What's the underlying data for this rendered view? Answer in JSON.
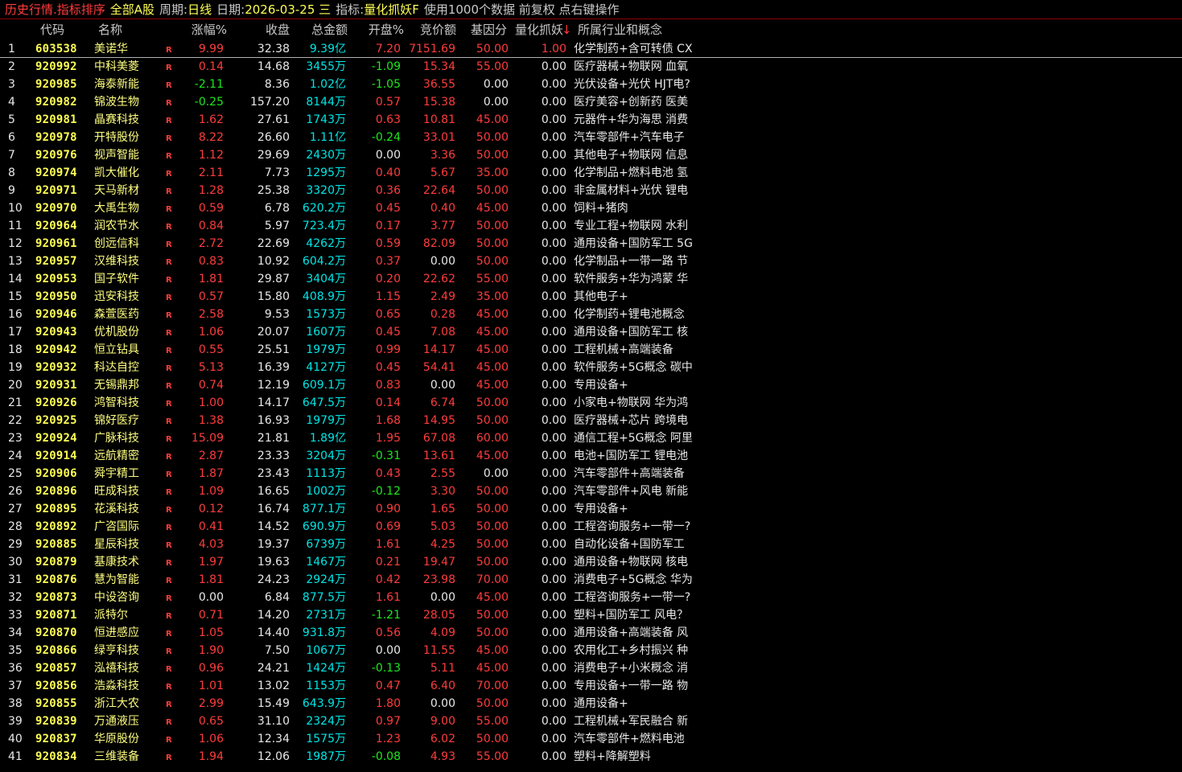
{
  "topbar": {
    "title": "历史行情.指标排序",
    "market": "全部A股",
    "period_label": "周期:",
    "period_value": "日线",
    "date_label": "日期:",
    "date_value": "2026-03-25 三",
    "indicator_label": "指标:",
    "indicator_value": "量化抓妖F",
    "hint": "使用1000个数据 前复权 点右键操作"
  },
  "columns": {
    "code": "代码",
    "name": "名称",
    "change_pct": "涨幅%",
    "close": "收盘",
    "amount": "总金额",
    "open_pct": "开盘%",
    "auction": "竞价额",
    "base_score": "基因分",
    "quant": "量化抓妖",
    "sort_arrow": "↓",
    "industry": "所属行业和概念"
  },
  "colors": {
    "up": "#ff3c3c",
    "down": "#1ee71e",
    "flat": "#e8e8e8",
    "code": "#ffff55",
    "amount": "#00e6e6"
  },
  "rows": [
    {
      "idx": "1",
      "code": "603538",
      "name": "美诺华",
      "mark": "R",
      "chg": "9.99",
      "close": "32.38",
      "amt": "9.39",
      "unit": "亿",
      "open": "7.20",
      "auction": "7151.69",
      "base": "50.00",
      "quant": "1.00",
      "ind": "化学制药+含可转债 CX"
    },
    {
      "idx": "2",
      "code": "920992",
      "name": "中科美菱",
      "mark": "R",
      "chg": "0.14",
      "close": "14.68",
      "amt": "3455",
      "unit": "万",
      "open": "-1.09",
      "auction": "15.34",
      "base": "55.00",
      "quant": "0.00",
      "ind": "医疗器械+物联网 血氧"
    },
    {
      "idx": "3",
      "code": "920985",
      "name": "海泰新能",
      "mark": "R",
      "chg": "-2.11",
      "close": "8.36",
      "amt": "1.02",
      "unit": "亿",
      "open": "-1.05",
      "auction": "36.55",
      "base": "0.00",
      "quant": "0.00",
      "ind": "光伏设备+光伏 HJT电?"
    },
    {
      "idx": "4",
      "code": "920982",
      "name": "锦波生物",
      "mark": "R",
      "chg": "-0.25",
      "close": "157.20",
      "amt": "8144",
      "unit": "万",
      "open": "0.57",
      "auction": "15.38",
      "base": "0.00",
      "quant": "0.00",
      "ind": "医疗美容+创新药 医美"
    },
    {
      "idx": "5",
      "code": "920981",
      "name": "晶赛科技",
      "mark": "R",
      "chg": "1.62",
      "close": "27.61",
      "amt": "1743",
      "unit": "万",
      "open": "0.63",
      "auction": "10.81",
      "base": "45.00",
      "quant": "0.00",
      "ind": "元器件+华为海思 消费"
    },
    {
      "idx": "6",
      "code": "920978",
      "name": "开特股份",
      "mark": "R",
      "chg": "8.22",
      "close": "26.60",
      "amt": "1.11",
      "unit": "亿",
      "open": "-0.24",
      "auction": "33.01",
      "base": "50.00",
      "quant": "0.00",
      "ind": "汽车零部件+汽车电子"
    },
    {
      "idx": "7",
      "code": "920976",
      "name": "视声智能",
      "mark": "R",
      "chg": "1.12",
      "close": "29.69",
      "amt": "2430",
      "unit": "万",
      "open": "0.00",
      "auction": "3.36",
      "base": "50.00",
      "quant": "0.00",
      "ind": "其他电子+物联网 信息"
    },
    {
      "idx": "8",
      "code": "920974",
      "name": "凯大催化",
      "mark": "R",
      "chg": "2.11",
      "close": "7.73",
      "amt": "1295",
      "unit": "万",
      "open": "0.40",
      "auction": "5.67",
      "base": "35.00",
      "quant": "0.00",
      "ind": "化学制品+燃料电池 氢"
    },
    {
      "idx": "9",
      "code": "920971",
      "name": "天马新材",
      "mark": "R",
      "chg": "1.28",
      "close": "25.38",
      "amt": "3320",
      "unit": "万",
      "open": "0.36",
      "auction": "22.64",
      "base": "50.00",
      "quant": "0.00",
      "ind": "非金属材料+光伏 锂电"
    },
    {
      "idx": "10",
      "code": "920970",
      "name": "大禹生物",
      "mark": "R",
      "chg": "0.59",
      "close": "6.78",
      "amt": "620.2",
      "unit": "万",
      "open": "0.45",
      "auction": "0.40",
      "base": "45.00",
      "quant": "0.00",
      "ind": "饲料+猪肉"
    },
    {
      "idx": "11",
      "code": "920964",
      "name": "润农节水",
      "mark": "R",
      "chg": "0.84",
      "close": "5.97",
      "amt": "723.4",
      "unit": "万",
      "open": "0.17",
      "auction": "3.77",
      "base": "50.00",
      "quant": "0.00",
      "ind": "专业工程+物联网 水利"
    },
    {
      "idx": "12",
      "code": "920961",
      "name": "创远信科",
      "mark": "R",
      "chg": "2.72",
      "close": "22.69",
      "amt": "4262",
      "unit": "万",
      "open": "0.59",
      "auction": "82.09",
      "base": "50.00",
      "quant": "0.00",
      "ind": "通用设备+国防军工 5G"
    },
    {
      "idx": "13",
      "code": "920957",
      "name": "汉维科技",
      "mark": "R",
      "chg": "0.83",
      "close": "10.92",
      "amt": "604.2",
      "unit": "万",
      "open": "0.37",
      "auction": "0.00",
      "base": "50.00",
      "quant": "0.00",
      "ind": "化学制品+一带一路 节"
    },
    {
      "idx": "14",
      "code": "920953",
      "name": "国子软件",
      "mark": "R",
      "chg": "1.81",
      "close": "29.87",
      "amt": "3404",
      "unit": "万",
      "open": "0.20",
      "auction": "22.62",
      "base": "55.00",
      "quant": "0.00",
      "ind": "软件服务+华为鸿蒙 华"
    },
    {
      "idx": "15",
      "code": "920950",
      "name": "迅安科技",
      "mark": "R",
      "chg": "0.57",
      "close": "15.80",
      "amt": "408.9",
      "unit": "万",
      "open": "1.15",
      "auction": "2.49",
      "base": "35.00",
      "quant": "0.00",
      "ind": "其他电子+"
    },
    {
      "idx": "16",
      "code": "920946",
      "name": "森萱医药",
      "mark": "R",
      "chg": "2.58",
      "close": "9.53",
      "amt": "1573",
      "unit": "万",
      "open": "0.65",
      "auction": "0.28",
      "base": "45.00",
      "quant": "0.00",
      "ind": "化学制药+锂电池概念"
    },
    {
      "idx": "17",
      "code": "920943",
      "name": "优机股份",
      "mark": "R",
      "chg": "1.06",
      "close": "20.07",
      "amt": "1607",
      "unit": "万",
      "open": "0.45",
      "auction": "7.08",
      "base": "45.00",
      "quant": "0.00",
      "ind": "通用设备+国防军工 核"
    },
    {
      "idx": "18",
      "code": "920942",
      "name": "恒立钻具",
      "mark": "R",
      "chg": "0.55",
      "close": "25.51",
      "amt": "1979",
      "unit": "万",
      "open": "0.99",
      "auction": "14.17",
      "base": "45.00",
      "quant": "0.00",
      "ind": "工程机械+高端装备"
    },
    {
      "idx": "19",
      "code": "920932",
      "name": "科达自控",
      "mark": "R",
      "chg": "5.13",
      "close": "16.39",
      "amt": "4127",
      "unit": "万",
      "open": "0.45",
      "auction": "54.41",
      "base": "45.00",
      "quant": "0.00",
      "ind": "软件服务+5G概念 碳中"
    },
    {
      "idx": "20",
      "code": "920931",
      "name": "无锡鼎邦",
      "mark": "R",
      "chg": "0.74",
      "close": "12.19",
      "amt": "609.1",
      "unit": "万",
      "open": "0.83",
      "auction": "0.00",
      "base": "45.00",
      "quant": "0.00",
      "ind": "专用设备+"
    },
    {
      "idx": "21",
      "code": "920926",
      "name": "鸿智科技",
      "mark": "R",
      "chg": "1.00",
      "close": "14.17",
      "amt": "647.5",
      "unit": "万",
      "open": "0.14",
      "auction": "6.74",
      "base": "50.00",
      "quant": "0.00",
      "ind": "小家电+物联网 华为鸿"
    },
    {
      "idx": "22",
      "code": "920925",
      "name": "锦好医疗",
      "mark": "R",
      "chg": "1.38",
      "close": "16.93",
      "amt": "1979",
      "unit": "万",
      "open": "1.68",
      "auction": "14.95",
      "base": "50.00",
      "quant": "0.00",
      "ind": "医疗器械+芯片 跨境电"
    },
    {
      "idx": "23",
      "code": "920924",
      "name": "广脉科技",
      "mark": "R",
      "chg": "15.09",
      "close": "21.81",
      "amt": "1.89",
      "unit": "亿",
      "open": "1.95",
      "auction": "67.08",
      "base": "60.00",
      "quant": "0.00",
      "ind": "通信工程+5G概念 阿里"
    },
    {
      "idx": "24",
      "code": "920914",
      "name": "远航精密",
      "mark": "R",
      "chg": "2.87",
      "close": "23.33",
      "amt": "3204",
      "unit": "万",
      "open": "-0.31",
      "auction": "13.61",
      "base": "45.00",
      "quant": "0.00",
      "ind": "电池+国防军工 锂电池"
    },
    {
      "idx": "25",
      "code": "920906",
      "name": "舜宇精工",
      "mark": "R",
      "chg": "1.87",
      "close": "23.43",
      "amt": "1113",
      "unit": "万",
      "open": "0.43",
      "auction": "2.55",
      "base": "0.00",
      "quant": "0.00",
      "ind": "汽车零部件+高端装备"
    },
    {
      "idx": "26",
      "code": "920896",
      "name": "旺成科技",
      "mark": "R",
      "chg": "1.09",
      "close": "16.65",
      "amt": "1002",
      "unit": "万",
      "open": "-0.12",
      "auction": "3.30",
      "base": "50.00",
      "quant": "0.00",
      "ind": "汽车零部件+风电 新能"
    },
    {
      "idx": "27",
      "code": "920895",
      "name": "花溪科技",
      "mark": "R",
      "chg": "0.12",
      "close": "16.74",
      "amt": "877.1",
      "unit": "万",
      "open": "0.90",
      "auction": "1.65",
      "base": "50.00",
      "quant": "0.00",
      "ind": "专用设备+"
    },
    {
      "idx": "28",
      "code": "920892",
      "name": "广咨国际",
      "mark": "R",
      "chg": "0.41",
      "close": "14.52",
      "amt": "690.9",
      "unit": "万",
      "open": "0.69",
      "auction": "5.03",
      "base": "50.00",
      "quant": "0.00",
      "ind": "工程咨询服务+一带一?"
    },
    {
      "idx": "29",
      "code": "920885",
      "name": "星辰科技",
      "mark": "R",
      "chg": "4.03",
      "close": "19.37",
      "amt": "6739",
      "unit": "万",
      "open": "1.61",
      "auction": "4.25",
      "base": "50.00",
      "quant": "0.00",
      "ind": "自动化设备+国防军工"
    },
    {
      "idx": "30",
      "code": "920879",
      "name": "基康技术",
      "mark": "R",
      "chg": "1.97",
      "close": "19.63",
      "amt": "1467",
      "unit": "万",
      "open": "0.21",
      "auction": "19.47",
      "base": "50.00",
      "quant": "0.00",
      "ind": "通用设备+物联网 核电"
    },
    {
      "idx": "31",
      "code": "920876",
      "name": "慧为智能",
      "mark": "R",
      "chg": "1.81",
      "close": "24.23",
      "amt": "2924",
      "unit": "万",
      "open": "0.42",
      "auction": "23.98",
      "base": "70.00",
      "quant": "0.00",
      "ind": "消费电子+5G概念 华为"
    },
    {
      "idx": "32",
      "code": "920873",
      "name": "中设咨询",
      "mark": "R",
      "chg": "0.00",
      "close": "6.84",
      "amt": "877.5",
      "unit": "万",
      "open": "1.61",
      "auction": "0.00",
      "base": "45.00",
      "quant": "0.00",
      "ind": "工程咨询服务+一带一?"
    },
    {
      "idx": "33",
      "code": "920871",
      "name": "派特尔",
      "mark": "R",
      "chg": "0.71",
      "close": "14.20",
      "amt": "2731",
      "unit": "万",
      "open": "-1.21",
      "auction": "28.05",
      "base": "50.00",
      "quant": "0.00",
      "ind": "塑料+国防军工 风电？"
    },
    {
      "idx": "34",
      "code": "920870",
      "name": "恒进感应",
      "mark": "R",
      "chg": "1.05",
      "close": "14.40",
      "amt": "931.8",
      "unit": "万",
      "open": "0.56",
      "auction": "4.09",
      "base": "50.00",
      "quant": "0.00",
      "ind": "通用设备+高端装备 风"
    },
    {
      "idx": "35",
      "code": "920866",
      "name": "绿亨科技",
      "mark": "R",
      "chg": "1.90",
      "close": "7.50",
      "amt": "1067",
      "unit": "万",
      "open": "0.00",
      "auction": "11.55",
      "base": "45.00",
      "quant": "0.00",
      "ind": "农用化工+乡村振兴 种"
    },
    {
      "idx": "36",
      "code": "920857",
      "name": "泓禧科技",
      "mark": "R",
      "chg": "0.96",
      "close": "24.21",
      "amt": "1424",
      "unit": "万",
      "open": "-0.13",
      "auction": "5.11",
      "base": "45.00",
      "quant": "0.00",
      "ind": "消费电子+小米概念 消"
    },
    {
      "idx": "37",
      "code": "920856",
      "name": "浩淼科技",
      "mark": "R",
      "chg": "1.01",
      "close": "13.02",
      "amt": "1153",
      "unit": "万",
      "open": "0.47",
      "auction": "6.40",
      "base": "70.00",
      "quant": "0.00",
      "ind": "专用设备+一带一路 物"
    },
    {
      "idx": "38",
      "code": "920855",
      "name": "浙江大农",
      "mark": "R",
      "chg": "2.99",
      "close": "15.49",
      "amt": "643.9",
      "unit": "万",
      "open": "1.80",
      "auction": "0.00",
      "base": "50.00",
      "quant": "0.00",
      "ind": "通用设备+"
    },
    {
      "idx": "39",
      "code": "920839",
      "name": "万通液压",
      "mark": "R",
      "chg": "0.65",
      "close": "31.10",
      "amt": "2324",
      "unit": "万",
      "open": "0.97",
      "auction": "9.00",
      "base": "55.00",
      "quant": "0.00",
      "ind": "工程机械+军民融合 新"
    },
    {
      "idx": "40",
      "code": "920837",
      "name": "华原股份",
      "mark": "R",
      "chg": "1.06",
      "close": "12.34",
      "amt": "1575",
      "unit": "万",
      "open": "1.23",
      "auction": "6.02",
      "base": "50.00",
      "quant": "0.00",
      "ind": "汽车零部件+燃料电池"
    },
    {
      "idx": "41",
      "code": "920834",
      "name": "三维装备",
      "mark": "R",
      "chg": "1.94",
      "close": "12.06",
      "amt": "1987",
      "unit": "万",
      "open": "-0.08",
      "auction": "4.93",
      "base": "55.00",
      "quant": "0.00",
      "ind": "塑料+降解塑料"
    }
  ]
}
